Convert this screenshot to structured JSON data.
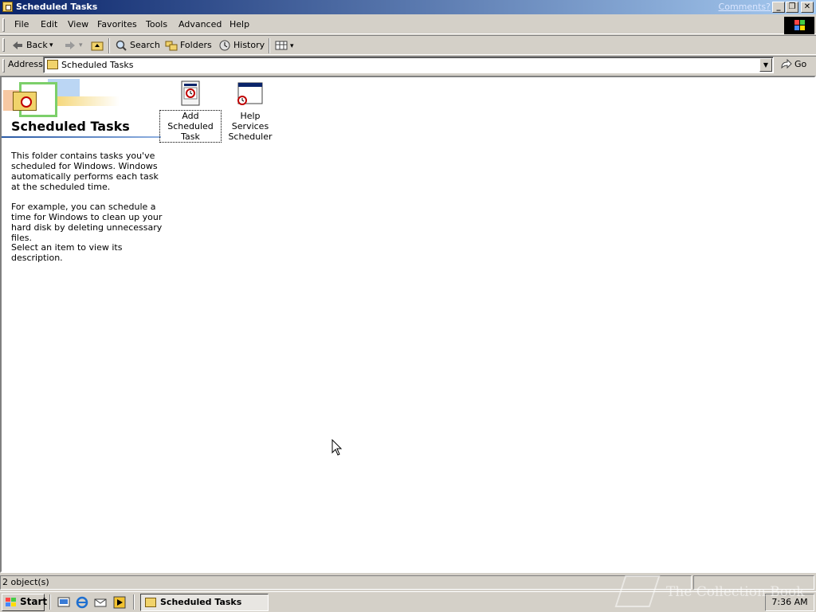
{
  "window": {
    "title": "Scheduled Tasks",
    "comments_link": "Comments?",
    "buttons": {
      "minimize": "_",
      "restore": "❐",
      "close": "✕"
    }
  },
  "menubar": {
    "items": [
      "File",
      "Edit",
      "View",
      "Favorites",
      "Tools",
      "Advanced",
      "Help"
    ]
  },
  "toolbar": {
    "back_label": "Back",
    "forward_label": "",
    "search_label": "Search",
    "folders_label": "Folders",
    "history_label": "History",
    "dropdown_glyph": "▾"
  },
  "address": {
    "label": "Address",
    "value": "Scheduled Tasks",
    "go_label": "Go",
    "dropdown_glyph": "▼"
  },
  "left_pane": {
    "title": "Scheduled Tasks",
    "paragraphs": [
      "This folder contains tasks you've scheduled for Windows. Windows automatically performs each task at the scheduled time.",
      "For example, you can schedule a time for Windows to clean up your hard disk by deleting unnecessary files.",
      "Select an item to view its description."
    ]
  },
  "items": [
    {
      "label": "Add Scheduled Task",
      "icon": "add-scheduled-task-icon",
      "selected": true
    },
    {
      "label": "Help Services Scheduler",
      "icon": "scheduled-task-window-icon",
      "selected": false
    }
  ],
  "statusbar": {
    "object_count": "2 object(s)"
  },
  "taskbar": {
    "start_label": "Start",
    "task_button_label": "Scheduled Tasks",
    "clock": "7:36 AM",
    "watermark": "The Collection Book"
  },
  "colors": {
    "titlebar_start": "#0a246a",
    "titlebar_end": "#a6caf0",
    "face": "#d4d0c8"
  }
}
